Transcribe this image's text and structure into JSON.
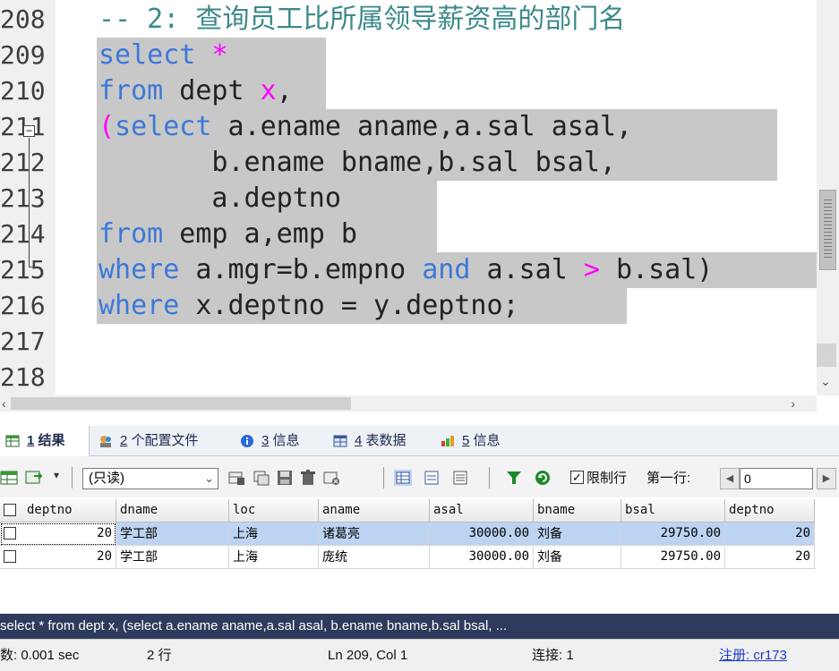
{
  "editor": {
    "lines": [
      {
        "no": "208",
        "parts": [
          {
            "t": "-- 2: 查询员工比所属领导薪资高的部门名",
            "c": "cm"
          }
        ],
        "selected": false
      },
      {
        "no": "209",
        "parts": [
          {
            "t": "select",
            "c": "kw"
          },
          {
            "t": " ",
            "c": "id"
          },
          {
            "t": "*",
            "c": "op"
          }
        ],
        "selected": true
      },
      {
        "no": "210",
        "parts": [
          {
            "t": "from",
            "c": "kw"
          },
          {
            "t": " dept ",
            "c": "id"
          },
          {
            "t": "x",
            "c": "op"
          },
          {
            "t": ",",
            "c": "id"
          }
        ],
        "selected": true
      },
      {
        "no": "211",
        "parts": [
          {
            "t": "(",
            "c": "op"
          },
          {
            "t": "select",
            "c": "kw"
          },
          {
            "t": " a.ename aname,a.sal asal,",
            "c": "id"
          }
        ],
        "selected": true
      },
      {
        "no": "212",
        "parts": [
          {
            "t": "       b.ename bname,b.sal bsal,",
            "c": "id"
          }
        ],
        "selected": true
      },
      {
        "no": "213",
        "parts": [
          {
            "t": "       a.deptno",
            "c": "id"
          }
        ],
        "selected": true
      },
      {
        "no": "214",
        "parts": [
          {
            "t": "from",
            "c": "kw"
          },
          {
            "t": " emp a,emp b",
            "c": "id"
          }
        ],
        "selected": true
      },
      {
        "no": "215",
        "parts": [
          {
            "t": "where",
            "c": "kw"
          },
          {
            "t": " a.mgr=b.empno ",
            "c": "id"
          },
          {
            "t": "and",
            "c": "kw"
          },
          {
            "t": " a.sal ",
            "c": "id"
          },
          {
            "t": ">",
            "c": "op"
          },
          {
            "t": " b.sal)",
            "c": "id"
          }
        ],
        "selected": true
      },
      {
        "no": "216",
        "parts": [
          {
            "t": "where",
            "c": "kw"
          },
          {
            "t": " x.deptno = y.deptno;",
            "c": "id"
          }
        ],
        "selected": true
      },
      {
        "no": "217",
        "parts": [],
        "selected": false
      },
      {
        "no": "218",
        "parts": [],
        "selected": false
      }
    ],
    "fold_marker": "−"
  },
  "tabs": [
    {
      "num": "1",
      "label": "结果",
      "icon": "grid-result-icon",
      "active": true
    },
    {
      "num": "2",
      "label": "个配置文件",
      "icon": "profile-icon",
      "active": false
    },
    {
      "num": "3",
      "label": "信息",
      "icon": "info-icon",
      "active": false
    },
    {
      "num": "4",
      "label": "表数据",
      "icon": "table-icon",
      "active": false
    },
    {
      "num": "5",
      "label": "信息",
      "icon": "info-color-icon",
      "active": false
    }
  ],
  "toolbar": {
    "mode_value": "(只读)",
    "limit_checked": "✓",
    "limit_label": "限制行",
    "first_row_label": "第一行:",
    "first_row_value": "0",
    "prev_label": "◀",
    "next_label": "▶"
  },
  "grid": {
    "columns": [
      "deptno",
      "dname",
      "loc",
      "aname",
      "asal",
      "bname",
      "bsal",
      "deptno"
    ],
    "rows": [
      [
        "20",
        "学工部",
        "上海",
        "诸葛亮",
        "30000.00",
        "刘备",
        "29750.00",
        "20"
      ],
      [
        "20",
        "学工部",
        "上海",
        "庞统",
        "30000.00",
        "刘备",
        "29750.00",
        "20"
      ]
    ]
  },
  "sql_bar": "select * from dept x, (select a.ename aname,a.sal asal, b.ename bname,b.sal bsal, ...",
  "status": {
    "duration": "数: 0.001 sec",
    "rows": "2 行",
    "cursor": "Ln 209, Col 1",
    "connection": "连接: 1",
    "register": "注册: cr173"
  },
  "colors": {
    "keyword": "#3c78d8",
    "operator": "#ff00ff",
    "comment": "#3c8a8a",
    "selection": "#c8c8c8",
    "sql_bar_bg": "#2e3b5c",
    "selected_row": "#bcd3f2"
  }
}
